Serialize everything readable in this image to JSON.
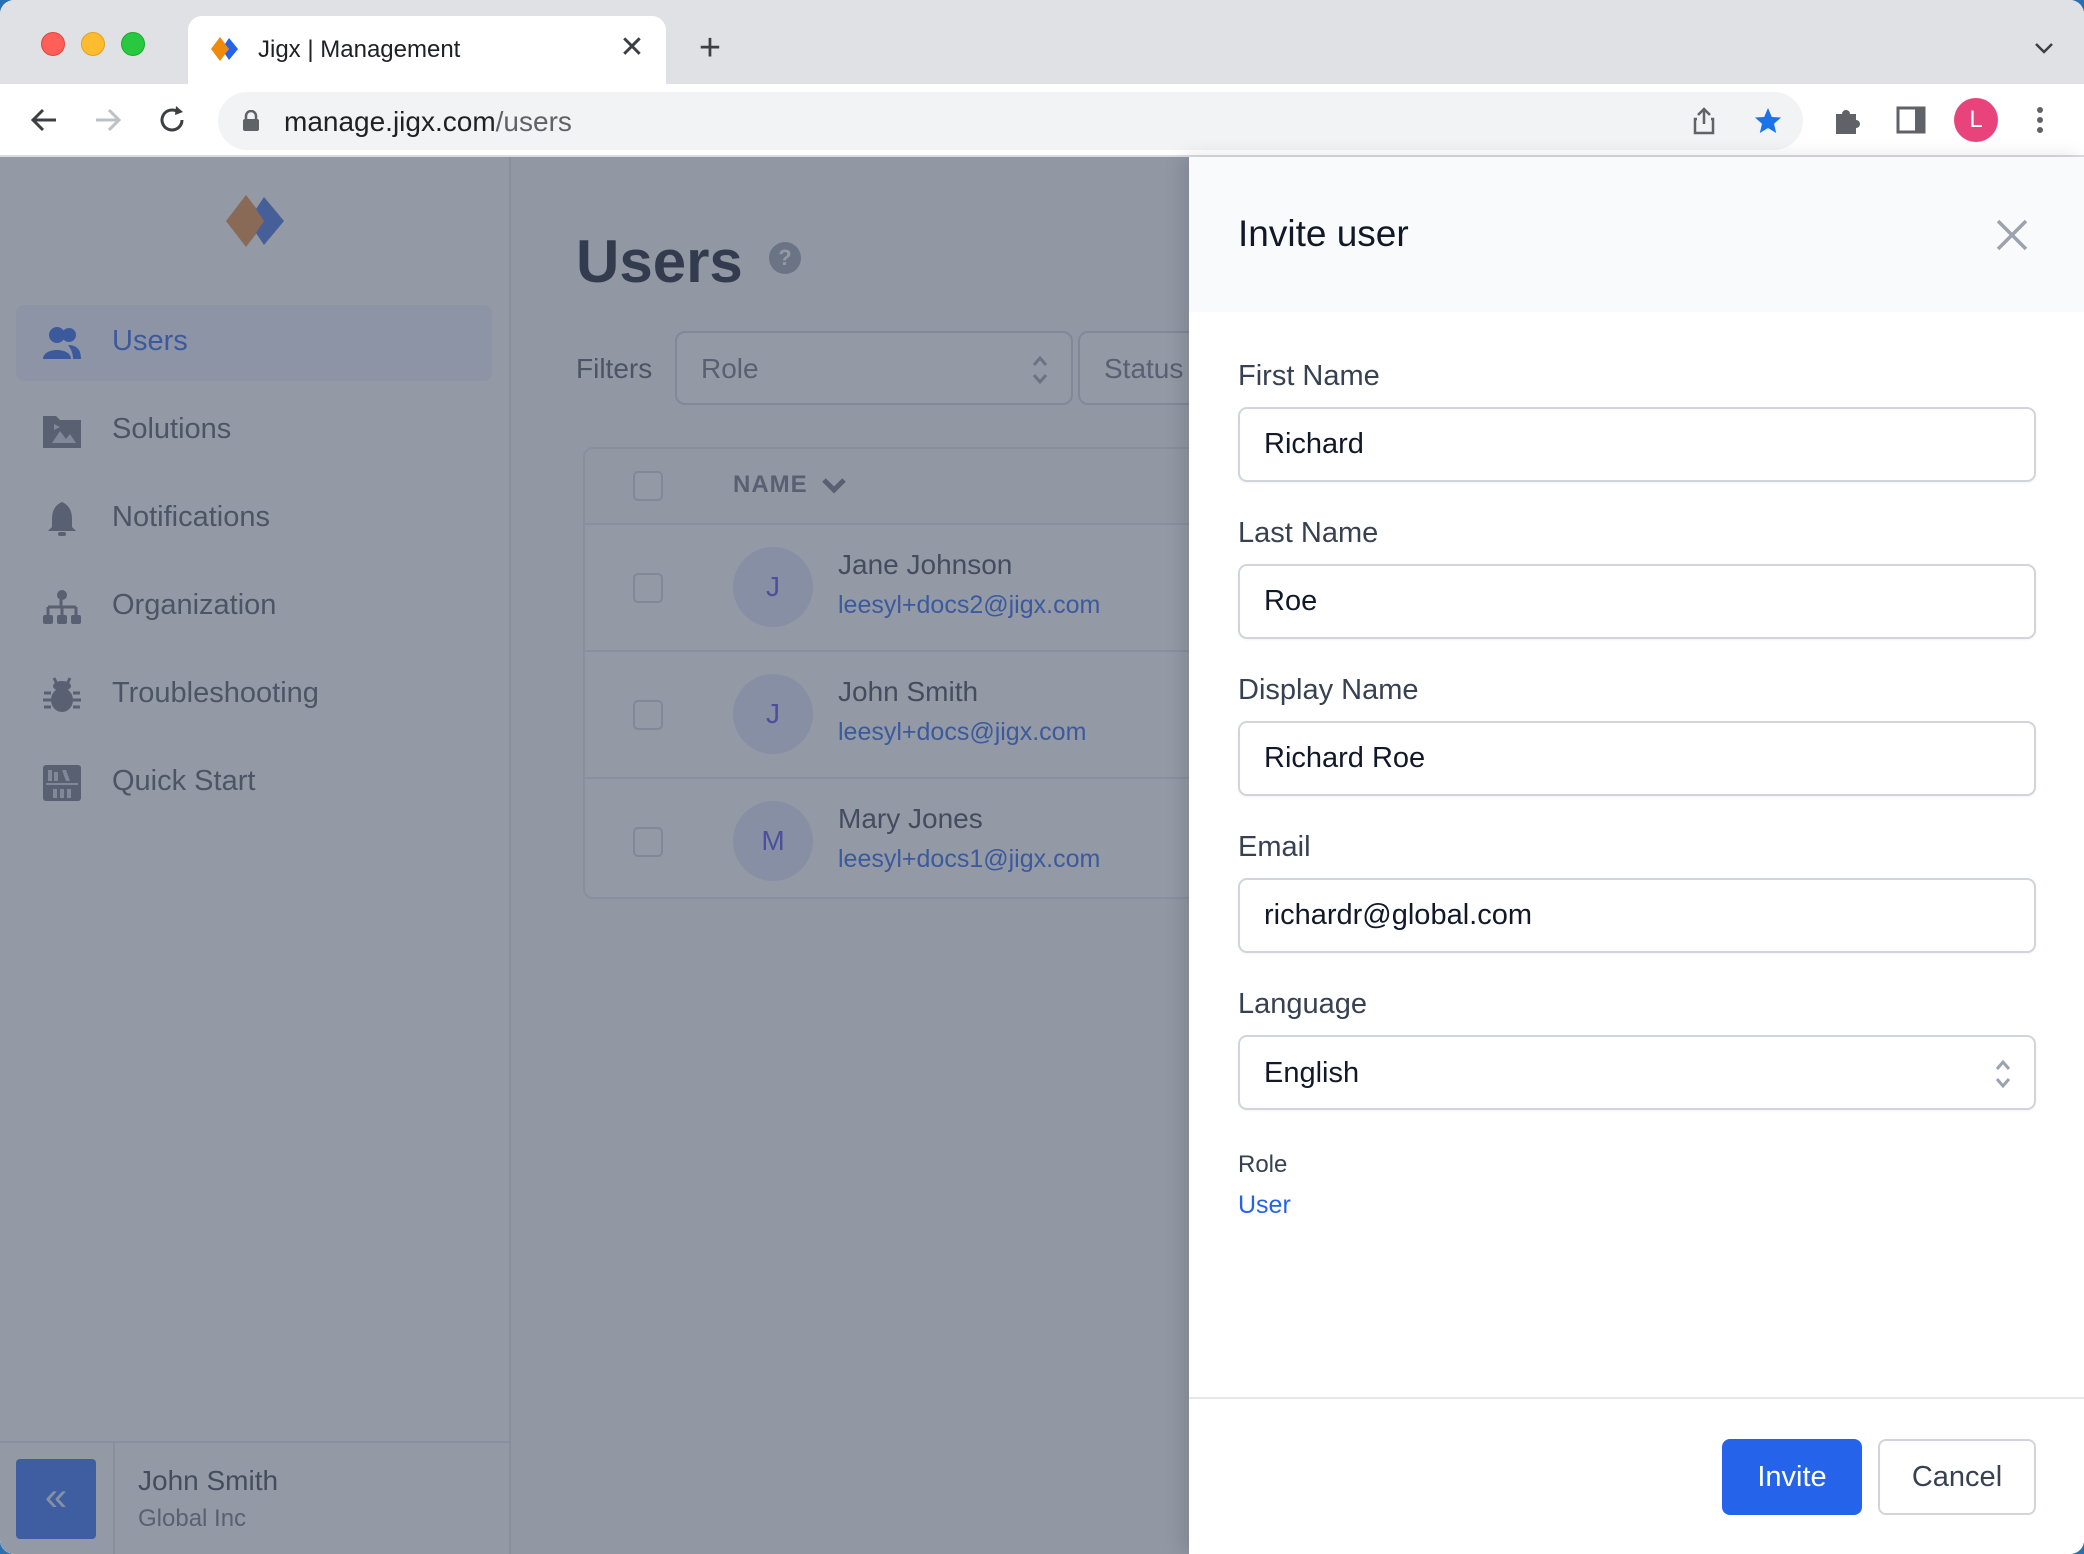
{
  "browser": {
    "tab_title": "Jigx | Management",
    "new_tab_symbol": "+",
    "close_symbol": "✕",
    "url_host": "manage.jigx.com",
    "url_path": "/users",
    "profile_initial": "L",
    "colors": {
      "profile": "#e8437a",
      "bookmark_star": "#1a73e8"
    }
  },
  "sidebar": {
    "items": [
      {
        "label": "Users",
        "icon": "users-icon",
        "active": true
      },
      {
        "label": "Solutions",
        "icon": "folder-image-icon",
        "active": false
      },
      {
        "label": "Notifications",
        "icon": "bell-icon",
        "active": false
      },
      {
        "label": "Organization",
        "icon": "org-chart-icon",
        "active": false
      },
      {
        "label": "Troubleshooting",
        "icon": "bug-icon",
        "active": false
      },
      {
        "label": "Quick Start",
        "icon": "bookshelf-icon",
        "active": false
      }
    ],
    "footer": {
      "collapse_symbol": "«",
      "user_name": "John Smith",
      "org_name": "Global Inc"
    }
  },
  "main": {
    "title": "Users",
    "help_symbol": "?",
    "filters_label": "Filters",
    "filters": [
      {
        "placeholder": "Role"
      },
      {
        "placeholder": "Status"
      }
    ],
    "table": {
      "columns": [
        "NAME"
      ],
      "rows": [
        {
          "initial": "J",
          "name": "Jane Johnson",
          "email": "leesyl+docs2@jigx.com"
        },
        {
          "initial": "J",
          "name": "John Smith",
          "email": "leesyl+docs@jigx.com"
        },
        {
          "initial": "M",
          "name": "Mary Jones",
          "email": "leesyl+docs1@jigx.com"
        }
      ]
    }
  },
  "drawer": {
    "title": "Invite user",
    "fields": {
      "first_name": {
        "label": "First Name",
        "value": "Richard"
      },
      "last_name": {
        "label": "Last Name",
        "value": "Roe"
      },
      "display_name": {
        "label": "Display Name",
        "value": "Richard Roe"
      },
      "email": {
        "label": "Email",
        "value": "richardr@global.com"
      },
      "language": {
        "label": "Language",
        "value": "English"
      }
    },
    "role": {
      "label": "Role",
      "value": "User"
    },
    "buttons": {
      "invite": "Invite",
      "cancel": "Cancel"
    },
    "colors": {
      "primary": "#2563eb"
    }
  }
}
